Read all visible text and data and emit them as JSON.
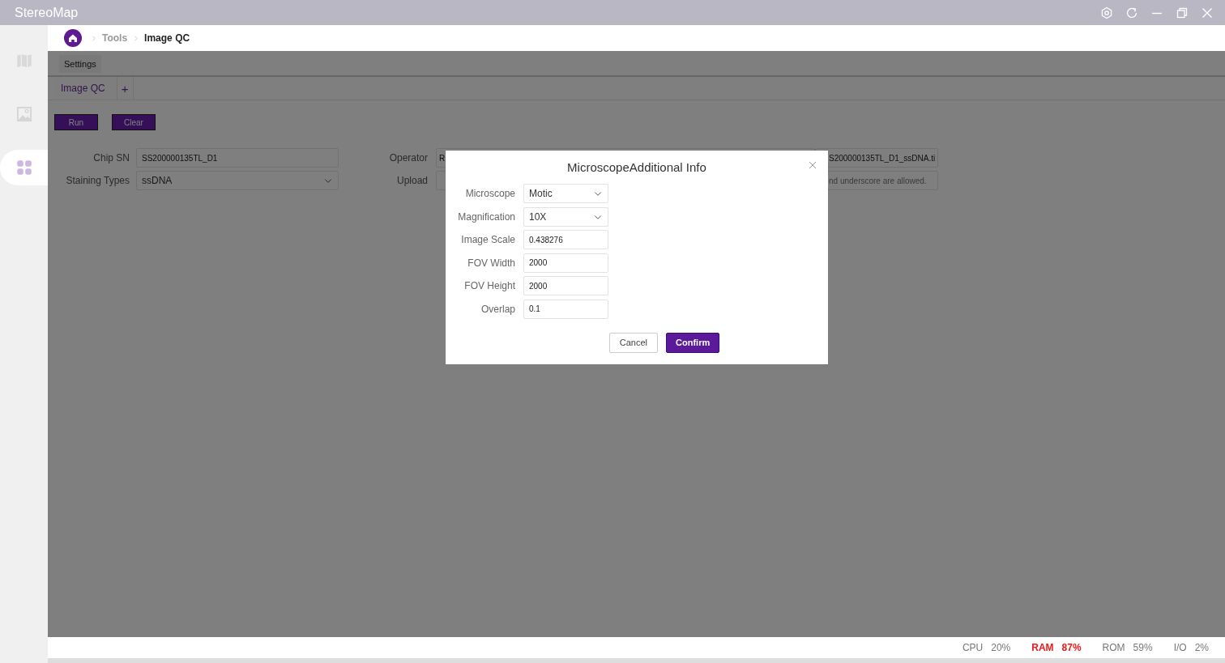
{
  "window": {
    "title": "StereoMap"
  },
  "sidebar": {
    "items": [
      {
        "kind": "map",
        "selected": false
      },
      {
        "kind": "image",
        "selected": false
      },
      {
        "kind": "apps",
        "selected": true
      }
    ]
  },
  "breadcrumb": [
    "Tools",
    "Image QC"
  ],
  "settings_tab": {
    "label": "Settings"
  },
  "tabs": [
    {
      "label": "Image QC",
      "selected": true
    }
  ],
  "add_tab": "+",
  "buttons": [
    "Run",
    "Clear"
  ],
  "form": {
    "fields": [
      {
        "label": "Chip SN",
        "kind": "text",
        "value": "SS200000135TL_D1"
      },
      {
        "label": "Operator",
        "kind": "text",
        "value": "R"
      },
      {
        "kind": "text",
        "value": "S200000135TL_D1_ssDNA.ti"
      },
      {
        "label": "Staining Types",
        "kind": "select",
        "value": "ssDNA"
      },
      {
        "label": "Upload",
        "kind": "text"
      },
      {
        "kind": "text",
        "placeholder": "nd underscore are allowed."
      }
    ]
  },
  "dialog": {
    "title": "MicroscopeAdditional Info",
    "fields": [
      {
        "label": "Microscope",
        "kind": "select",
        "value": "Motic"
      },
      {
        "label": "Magnification",
        "kind": "select",
        "value": "10X"
      },
      {
        "label": "Image Scale",
        "kind": "text",
        "value": "0.438276"
      },
      {
        "label": "FOV Width",
        "kind": "text",
        "value": "2000"
      },
      {
        "label": "FOV Height",
        "kind": "text",
        "value": "2000"
      },
      {
        "label": "Overlap",
        "kind": "text",
        "value": "0.1"
      }
    ],
    "buttons": [
      {
        "label": "Cancel",
        "primary": false
      },
      {
        "label": "Confirm",
        "primary": true
      }
    ]
  },
  "status_bar": [
    {
      "label": "CPU",
      "value": "20%",
      "warning": false
    },
    {
      "label": "RAM",
      "value": "87%",
      "warning": true
    },
    {
      "label": "ROM",
      "value": "59%",
      "warning": false
    },
    {
      "label": "I/O",
      "value": "2%",
      "warning": false
    }
  ]
}
